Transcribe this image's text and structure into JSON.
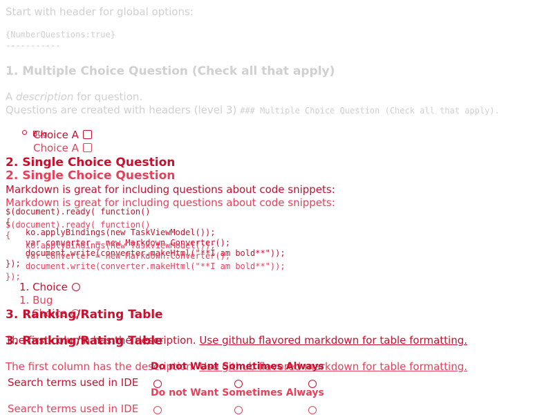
{
  "intro": {
    "header_line": "Start with header for global options:",
    "options": "{NumberQuestions:true}",
    "separator": "-----------"
  },
  "q1": {
    "heading": "1. Multiple Choice Question (Check all that apply)",
    "desc_pre": "A ",
    "desc_em": "description",
    "desc_post": " for question.",
    "note": "Questions are created with headers (level 3)",
    "note_code": "### Multiple Choice Question (Check all that apply).",
    "choice_hidden": "Bug",
    "choice_label": "Choice A"
  },
  "q2": {
    "heading": "2. Single Choice Question",
    "text": "Markdown is great for including questions about code snippets:",
    "code_lines": [
      "$(document).ready( function()",
      "{",
      "    ko.applyBindings(new TaskViewModel());",
      "    var converter = new Markdown.Converter();",
      "    document.write(converter.makeHtml(\"**I am bold**\"));",
      "});"
    ],
    "choice_1": "1. Choice",
    "choice_bug": "1. Bug",
    "choice_overlap": "Choice"
  },
  "q3": {
    "heading": "3. Ranking/Rating Table",
    "text_pre": "The first column has the description.",
    "link": "Use github flavored markdown for table formatting.",
    "columns": [
      "Do not Want",
      "Sometimes",
      "Always"
    ],
    "row_label": "Search terms used in IDE"
  },
  "colors": {
    "faded": "#d0d0d0",
    "primary_red": "#c8102e",
    "secondary_red": "#e8405a"
  }
}
